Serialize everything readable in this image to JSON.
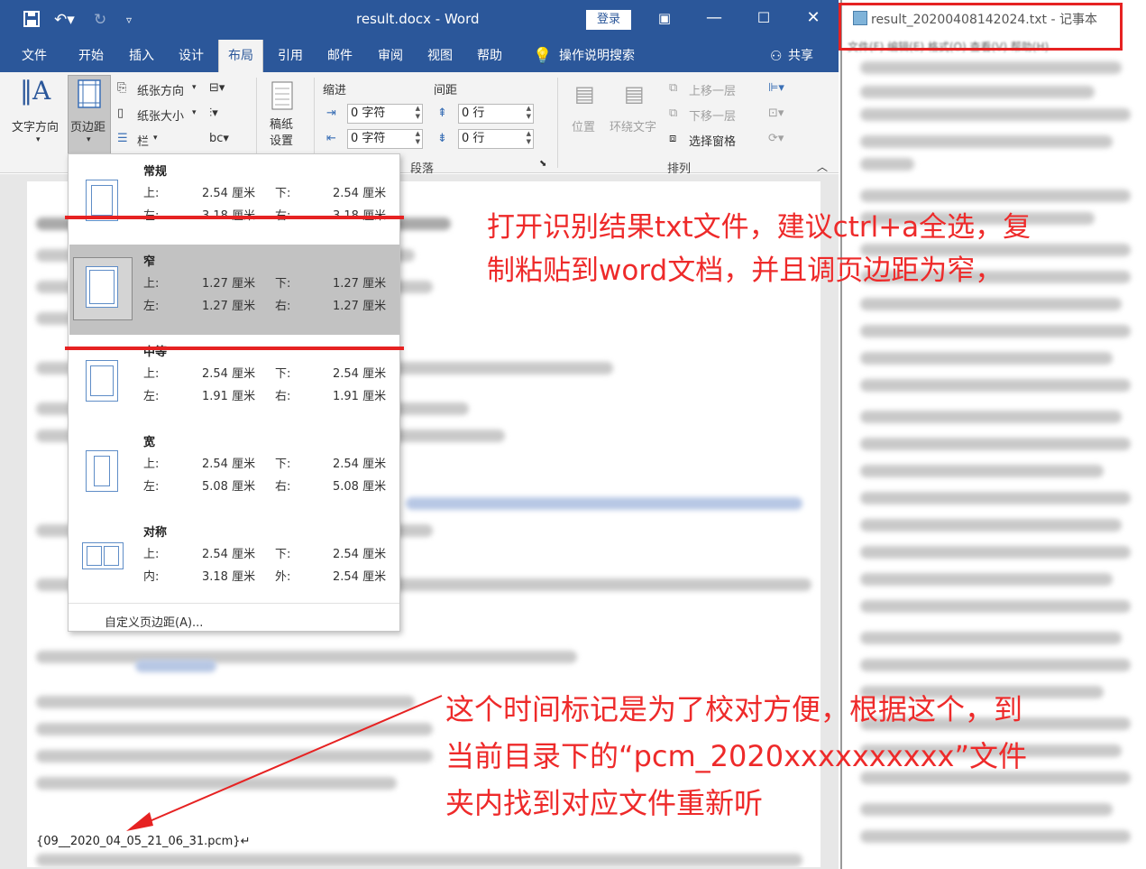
{
  "word": {
    "title": "result.docx  -  Word",
    "login": "登录",
    "tabs": [
      "文件",
      "开始",
      "插入",
      "设计",
      "布局",
      "引用",
      "邮件",
      "审阅",
      "视图",
      "帮助"
    ],
    "active_tab": "布局",
    "tell_me": "操作说明搜索",
    "share": "共享"
  },
  "ribbon": {
    "text_direction": "文字方向",
    "margins": "页边距",
    "orientation": "纸张方向",
    "size": "纸张大小",
    "columns": "栏",
    "draft_paper": "稿纸设置",
    "indent_label": "缩进",
    "spacing_label": "间距",
    "indent_left": "0 字符",
    "indent_right": "0 字符",
    "spacing_before": "0 行",
    "spacing_after": "0 行",
    "paragraph_group": "段落",
    "position": "位置",
    "wrap_text": "环绕文字",
    "bring_forward": "上移一层",
    "send_backward": "下移一层",
    "selection_pane": "选择窗格",
    "arrange_group": "排列"
  },
  "margins_menu": {
    "options": [
      {
        "name": "常规",
        "k1": "上:",
        "v1": "2.54 厘米",
        "k2": "下:",
        "v2": "2.54 厘米",
        "k3": "左:",
        "v3": "3.18 厘米",
        "k4": "右:",
        "v4": "3.18 厘米"
      },
      {
        "name": "窄",
        "k1": "上:",
        "v1": "1.27 厘米",
        "k2": "下:",
        "v2": "1.27 厘米",
        "k3": "左:",
        "v3": "1.27 厘米",
        "k4": "右:",
        "v4": "1.27 厘米"
      },
      {
        "name": "中等",
        "k1": "上:",
        "v1": "2.54 厘米",
        "k2": "下:",
        "v2": "2.54 厘米",
        "k3": "左:",
        "v3": "1.91 厘米",
        "k4": "右:",
        "v4": "1.91 厘米"
      },
      {
        "name": "宽",
        "k1": "上:",
        "v1": "2.54 厘米",
        "k2": "下:",
        "v2": "2.54 厘米",
        "k3": "左:",
        "v3": "5.08 厘米",
        "k4": "右:",
        "v4": "5.08 厘米"
      },
      {
        "name": "对称",
        "k1": "上:",
        "v1": "2.54 厘米",
        "k2": "下:",
        "v2": "2.54 厘米",
        "k3": "内:",
        "v3": "3.18 厘米",
        "k4": "外:",
        "v4": "2.54 厘米"
      }
    ],
    "selected": "窄",
    "custom": "自定义页边距(A)..."
  },
  "document": {
    "timestamp_line": "{09__2020_04_05_21_06_31.pcm}↵"
  },
  "notepad": {
    "title": "result_20200408142024.txt - 记事本",
    "menu": "文件(F)   编辑(E)   格式(O)   查看(V)   帮助(H)"
  },
  "annotations": {
    "note1_line1": "打开识别结果txt文件，建议ctrl+a全选，复",
    "note1_line2": "制粘贴到word文档，并且调页边距为窄，",
    "note2_line1": "这个时间标记是为了校对方便，根据这个，到",
    "note2_line2": "当前目录下的“pcm_2020xxxxxxxxxx”文件",
    "note2_line3": "夹内找到对应文件重新听",
    "color": "#ee2a2a"
  },
  "colors": {
    "word_blue": "#2b579a",
    "ribbon_bg": "#f3f3f3",
    "selected_option": "#c2c2c2"
  }
}
